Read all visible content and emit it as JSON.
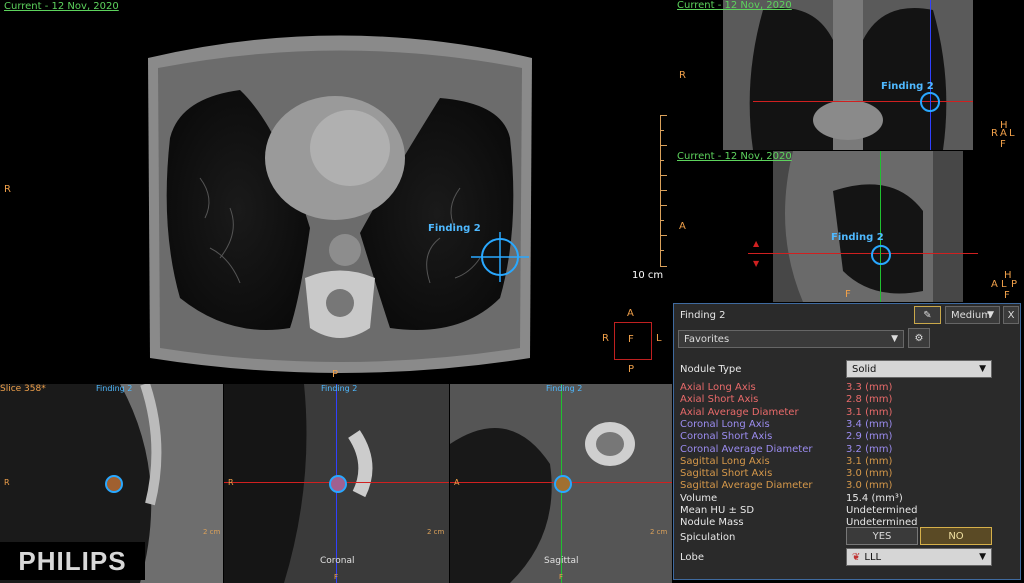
{
  "main_view": {
    "header": "Current - 12 Nov, 2020",
    "orient_left": "R",
    "orient_bottom": "P",
    "finding_label": "Finding 2",
    "scale_label": "10 cm"
  },
  "orientation_cube": {
    "top": "A",
    "left": "R",
    "center": "F",
    "right": "L",
    "bottom": "P"
  },
  "coronal_view": {
    "header": "Current - 12 Nov, 2020",
    "orient_left": "R",
    "finding_label": "Finding 2",
    "cube": {
      "h": "H",
      "r": "R",
      "a": "A",
      "l": "L",
      "f": "F"
    }
  },
  "sagittal_view": {
    "header": "Current - 12 Nov, 2020",
    "orient_left": "A",
    "orient_bottom": "F",
    "finding_label": "Finding 2",
    "cube": {
      "h": "H",
      "a": "A",
      "l": "L",
      "p": "P",
      "f": "F"
    }
  },
  "bottom_views": {
    "axial": {
      "slice": "Slice 358*",
      "finding": "Finding 2",
      "orient": "R",
      "scale": "2 cm"
    },
    "coronal": {
      "finding": "Finding 2",
      "orient_top": "P",
      "orient_left": "R",
      "label": "Coronal",
      "orient_bottom": "F",
      "scale": "2 cm"
    },
    "sagittal": {
      "finding": "Finding 2",
      "orient_left": "A",
      "label": "Sagittal",
      "orient_bottom": "F",
      "scale": "2 cm"
    }
  },
  "brand": "PHILIPS",
  "finding_panel": {
    "title": "Finding 2",
    "size_option": "Medium",
    "close": "X",
    "favorites": "Favorites",
    "nodule_type_label": "Nodule Type",
    "nodule_type_value": "Solid",
    "measurements": [
      {
        "label": "Axial Long Axis",
        "value": "3.3 (mm)",
        "kind": "axial"
      },
      {
        "label": "Axial Short Axis",
        "value": "2.8 (mm)",
        "kind": "axial"
      },
      {
        "label": "Axial Average Diameter",
        "value": "3.1 (mm)",
        "kind": "axial"
      },
      {
        "label": "Coronal Long Axis",
        "value": "3.4 (mm)",
        "kind": "coronal"
      },
      {
        "label": "Coronal Short Axis",
        "value": "2.9 (mm)",
        "kind": "coronal"
      },
      {
        "label": "Coronal Average Diameter",
        "value": "3.2 (mm)",
        "kind": "coronal"
      },
      {
        "label": "Sagittal Long Axis",
        "value": "3.1 (mm)",
        "kind": "sagittal"
      },
      {
        "label": "Sagittal Short Axis",
        "value": "3.0 (mm)",
        "kind": "sagittal"
      },
      {
        "label": "Sagittal Average Diameter",
        "value": "3.0 (mm)",
        "kind": "sagittal"
      },
      {
        "label": "Volume",
        "value": "15.4 (mm³)",
        "kind": "white"
      },
      {
        "label": "Mean HU ± SD",
        "value": "Undetermined",
        "kind": "white"
      },
      {
        "label": "Nodule Mass",
        "value": "Undetermined",
        "kind": "white"
      }
    ],
    "spiculation_label": "Spiculation",
    "spiculation_yes": "YES",
    "spiculation_no": "NO",
    "lobe_label": "Lobe",
    "lobe_value": "LLL"
  }
}
